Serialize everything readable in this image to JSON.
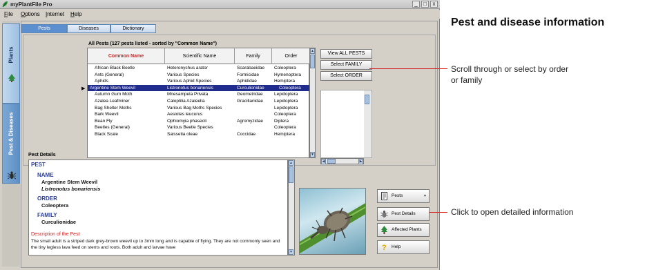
{
  "window": {
    "title": "myPlantFile Pro",
    "controls": {
      "minimize": "_",
      "maximize": "□",
      "close": "x"
    }
  },
  "menu": [
    {
      "label": "File",
      "accel": "F",
      "rest": "ile"
    },
    {
      "label": "Options",
      "accel": "O",
      "rest": "ptions"
    },
    {
      "label": "Internet",
      "accel": "I",
      "rest": "nternet"
    },
    {
      "label": "Help",
      "accel": "H",
      "rest": "elp"
    }
  ],
  "side_tabs": {
    "plants": "Plants",
    "pest": "Pest & Diseases"
  },
  "top_tabs": [
    "Pests",
    "Diseases",
    "Dictionary"
  ],
  "pest_list": {
    "caption": "All Pests (127 pests listed - sorted by \"Common Name\")",
    "columns": [
      "Common Name",
      "Scientific Name",
      "Family",
      "Order"
    ],
    "rows": [
      [
        "African Black Beetle",
        "Heteronychus arator",
        "Scarabaeidae",
        "Coleoptera"
      ],
      [
        "Ants (General)",
        "Various Species",
        "Formicidae",
        "Hymenoptera"
      ],
      [
        "Aphids",
        "Various Aphid Species",
        "Aphididae",
        "Hemiptera"
      ],
      [
        "Argentine Stem Weevil",
        "Listronotus bonariensis",
        "Curculionidae",
        "Coleoptera"
      ],
      [
        "Autumn Gum Moth",
        "Mnesampela Privata",
        "Geometridae",
        "Lepidoptera"
      ],
      [
        "Azalea Leafminer",
        "Caloptilia Azaleella",
        "Gracillariidae",
        "Lepidoptera"
      ],
      [
        "Bag Shelter Moths",
        "Various Bag Moths Species",
        "",
        "Lepidoptera"
      ],
      [
        "Bark Weevil",
        "Aesiotes leucurus",
        "",
        "Coleoptera"
      ],
      [
        "Bean Fly",
        "Ophiomyia phaseoli",
        "Agromyzidae",
        "Diptera"
      ],
      [
        "Beetles (General)",
        "Various Beetle Species",
        "",
        "Coleoptera"
      ],
      [
        "Black Scale",
        "Saissetia oleae",
        "Coccidae",
        "Hemiptera"
      ]
    ],
    "selected_index": 3
  },
  "list_buttons": [
    "View ALL PESTS",
    "Select FAMILY",
    "Select ORDER"
  ],
  "details": {
    "caption": "Pest Details",
    "header": "PEST",
    "name_label": "NAME",
    "name_value": "Argentine Stem Weevil",
    "name_scientific": "Listronotus bonariensis",
    "order_label": "ORDER",
    "order_value": "Coleoptera",
    "family_label": "FAMILY",
    "family_value": "Curculionidae",
    "description_label": "Description of the Pest",
    "description_text": "The small adult is a striped dark grey-brown weevil up to 3mm long and is capable of flying. They are not commonly seen and the tiny legless lava feed on stems and roots.  Both adult and larvae have"
  },
  "action_buttons": {
    "pests": "Pests",
    "pest_details": "Pest Details",
    "affected_plants": "Affected Plants",
    "help": "Help"
  },
  "annotations": {
    "title": "Pest and disease information",
    "scroll_note": "Scroll through or select by order or family",
    "details_note": "Click to open detailed information",
    "line_color": "#d41f1f"
  },
  "colors": {
    "selection": "#1f2c8c",
    "active_tab": "#5b8fd0",
    "section_heading": "#2a3e9c",
    "sorted_column": "#d02222"
  }
}
